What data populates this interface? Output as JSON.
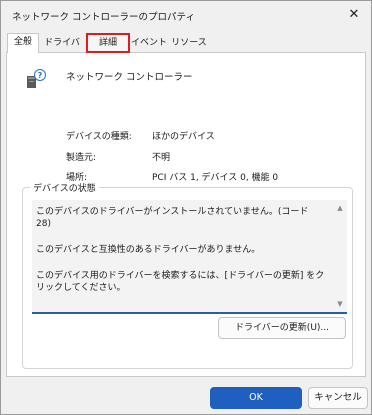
{
  "window": {
    "title": "ネットワーク コントローラーのプロパティ",
    "close_glyph": "✕"
  },
  "tabs": [
    {
      "label": "全般",
      "state": "active"
    },
    {
      "label": "ドライバー",
      "state": "normal"
    },
    {
      "label": "詳細",
      "state": "highlighted"
    },
    {
      "label": "イベント",
      "state": "normal"
    },
    {
      "label": "リソース",
      "state": "normal"
    }
  ],
  "device": {
    "icon": "network-device-unknown-icon",
    "name": "ネットワーク コントローラー"
  },
  "properties": [
    {
      "label": "デバイスの種類:",
      "value": "ほかのデバイス"
    },
    {
      "label": "製造元:",
      "value": "不明"
    },
    {
      "label": "場所:",
      "value": "PCI バス 1, デバイス 0, 機能 0"
    }
  ],
  "status_group": {
    "label": "デバイスの状態",
    "lines": [
      "このデバイスのドライバーがインストールされていません。(コード 28)",
      "このデバイスと互換性のあるドライバーがありません。",
      "このデバイス用のドライバーを検索するには、[ドライバーの更新] をクリックしてください。"
    ],
    "update_button": "ドライバーの更新(U)..."
  },
  "footer": {
    "ok": "OK",
    "cancel": "キャンセル"
  },
  "colors": {
    "highlight": "#e01b1b",
    "primary": "#1f5fbf",
    "focus_line": "#2b5da7"
  }
}
